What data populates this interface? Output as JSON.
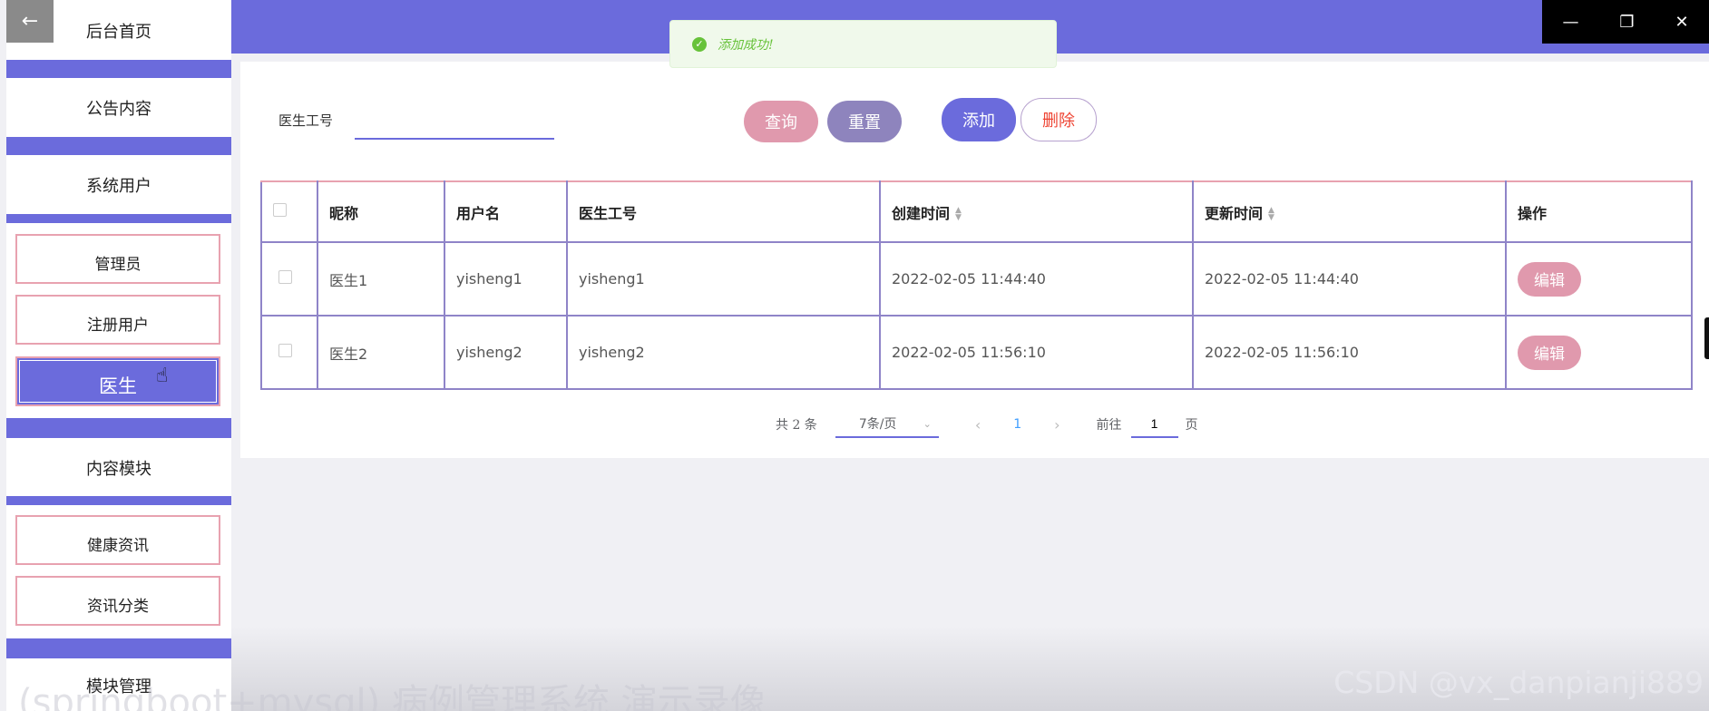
{
  "sidebar": {
    "back_glyph": "←",
    "items": [
      {
        "label": "后台首页"
      },
      {
        "label": "公告内容"
      },
      {
        "label": "系统用户"
      },
      {
        "label": "内容模块"
      },
      {
        "label": "模块管理"
      }
    ],
    "system_users_subs": [
      {
        "label": "管理员"
      },
      {
        "label": "注册用户"
      },
      {
        "label": "医生",
        "active": true
      }
    ],
    "content_subs": [
      {
        "label": "健康资讯"
      },
      {
        "label": "资讯分类"
      }
    ]
  },
  "toast": {
    "text": "添加成功!",
    "type": "success"
  },
  "search": {
    "label": "医生工号",
    "value": ""
  },
  "buttons": {
    "query": "查询",
    "reset": "重置",
    "add": "添加",
    "delete": "删除"
  },
  "table": {
    "columns": [
      "昵称",
      "用户名",
      "医生工号",
      "创建时间",
      "更新时间",
      "操作"
    ],
    "rows": [
      {
        "nickname": "医生1",
        "username": "yisheng1",
        "doctor_id": "yisheng1",
        "created": "2022-02-05 11:44:40",
        "updated": "2022-02-05 11:44:40",
        "action": "编辑"
      },
      {
        "nickname": "医生2",
        "username": "yisheng2",
        "doctor_id": "yisheng2",
        "created": "2022-02-05 11:56:10",
        "updated": "2022-02-05 11:56:10",
        "action": "编辑"
      }
    ]
  },
  "pagination": {
    "total_text": "共 2 条",
    "page_size": "7条/页",
    "current_page": "1",
    "goto_prefix": "前往",
    "goto_value": "1",
    "goto_suffix": "页"
  },
  "watermark": "CSDN @vx_danpianji889",
  "ghost_title": "(springboot+mysql) 病例管理系统 演示录像",
  "colors": {
    "primary": "#6b6bdc",
    "pink": "#e099ad",
    "purple_gray": "#8e84bd",
    "success": "#67c23a"
  }
}
